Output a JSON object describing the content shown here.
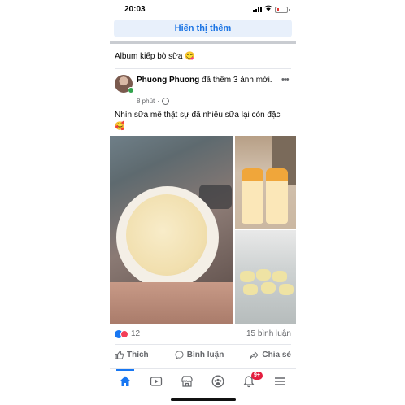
{
  "status_bar": {
    "time": "20:03"
  },
  "see_more": {
    "label": "Hiển thị thêm"
  },
  "album": {
    "title": "Album kiếp bò sữa 😋"
  },
  "post": {
    "author": "Phuong Phuong",
    "action": " đã thêm 3 ảnh mới.",
    "time": "8 phút",
    "caption": "Nhìn sữa mê thật sự đã nhiều sữa lại còn đặc 🥰"
  },
  "reactions": {
    "count": "12",
    "comments": "15 bình luận"
  },
  "actions": {
    "like": "Thích",
    "comment": "Bình luận",
    "share": "Chia sẻ"
  },
  "tabbar": {
    "items": [
      "home-icon",
      "video-icon",
      "marketplace-icon",
      "groups-icon",
      "notifications-icon",
      "menu-icon"
    ],
    "notification_badge": "9+",
    "accent": "#1877f2"
  }
}
